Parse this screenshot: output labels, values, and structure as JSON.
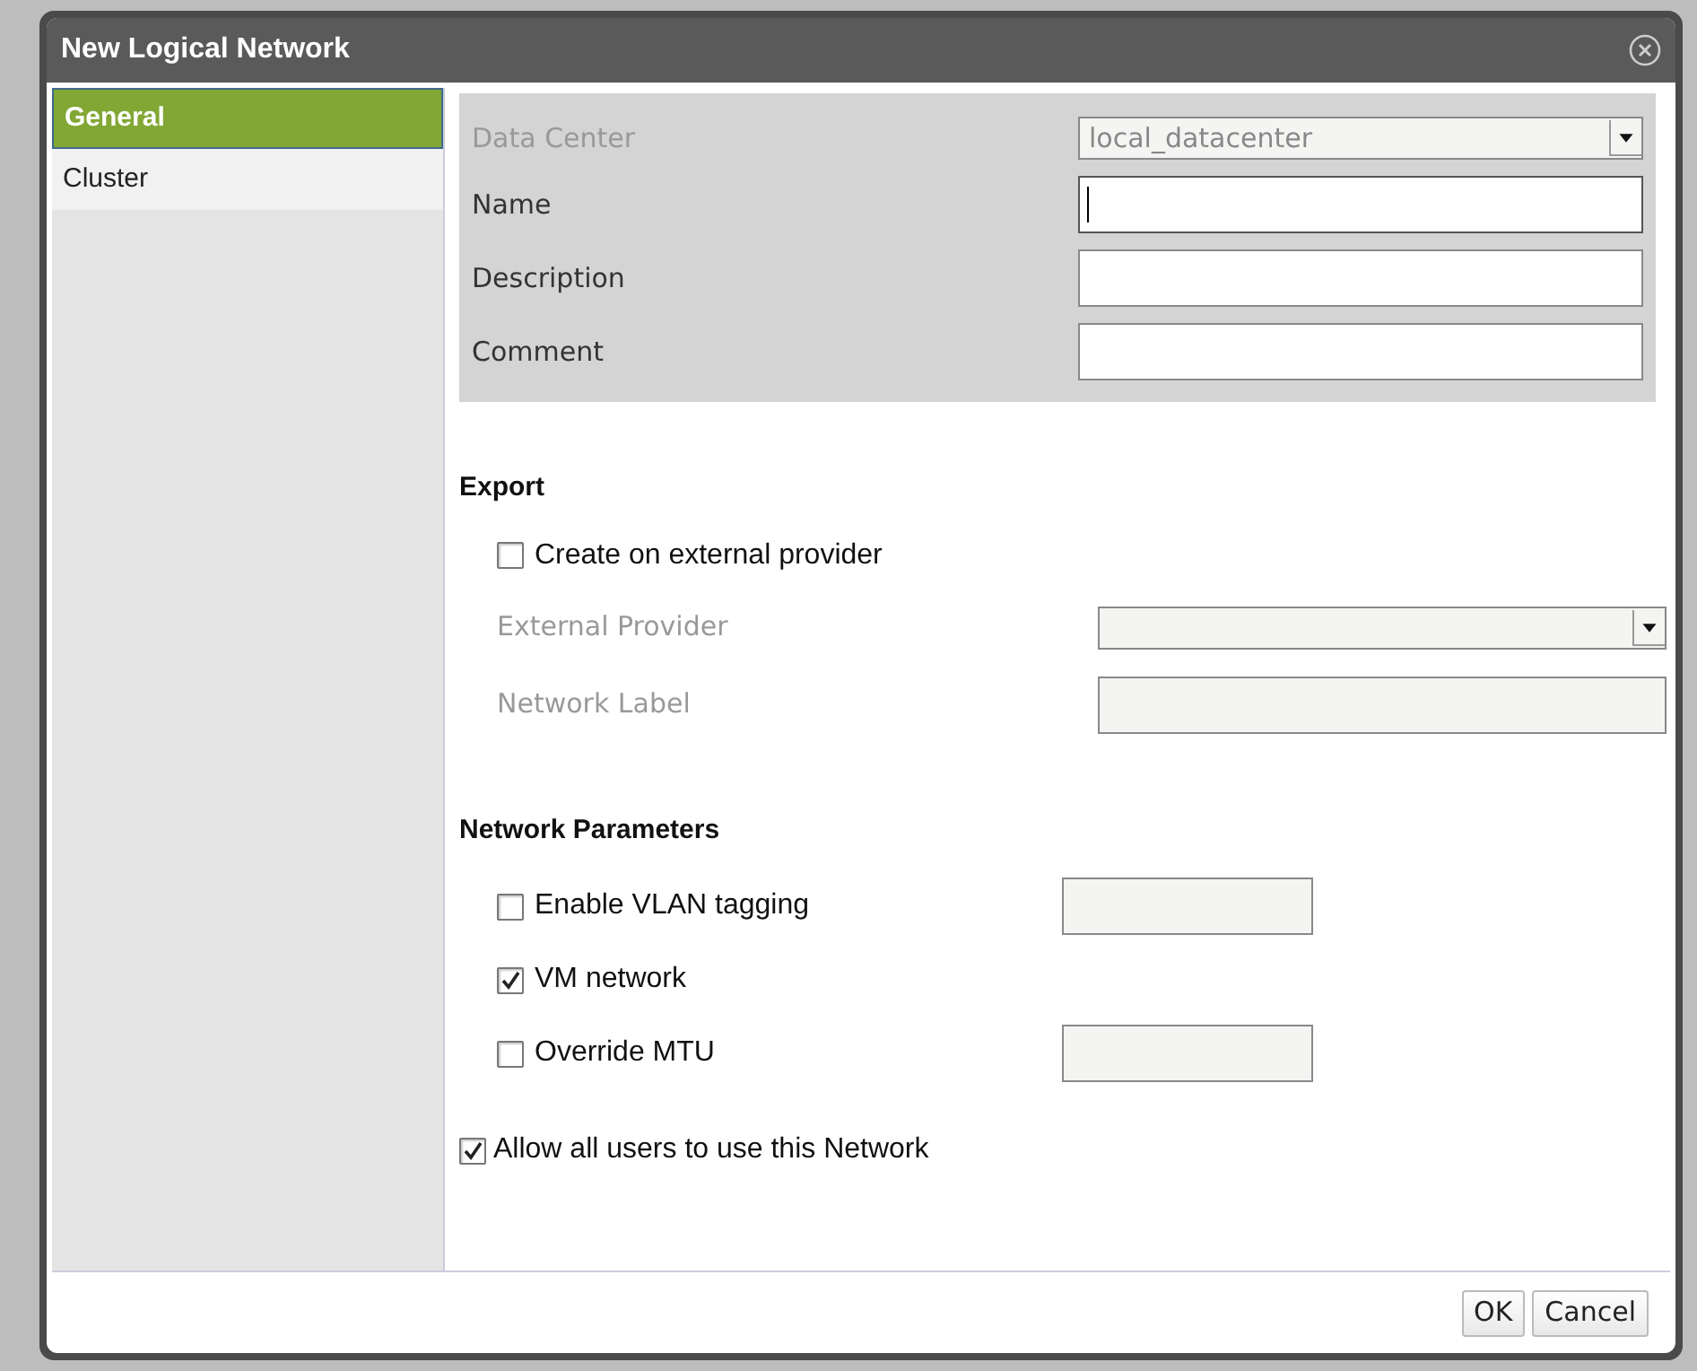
{
  "window": {
    "title": "New Logical Network"
  },
  "sidebar": {
    "items": [
      {
        "label": "General",
        "selected": true
      },
      {
        "label": "Cluster",
        "selected": false
      }
    ]
  },
  "general_fields": [
    {
      "label": "Data Center",
      "kind": "select",
      "disabled": true,
      "value": "local_datacenter"
    },
    {
      "label": "Name",
      "kind": "text",
      "disabled": false,
      "focused": true
    },
    {
      "label": "Description",
      "kind": "text",
      "disabled": false,
      "focused": false
    },
    {
      "label": "Comment",
      "kind": "text",
      "disabled": false,
      "focused": false
    }
  ],
  "export": {
    "heading": "Export",
    "create_checkbox": {
      "label": "Create on external provider",
      "checked": false
    },
    "fields": [
      {
        "label": "External Provider",
        "kind": "select",
        "disabled": true
      },
      {
        "label": "Network Label",
        "kind": "text",
        "disabled": true
      }
    ]
  },
  "network_parameters": {
    "heading": "Network Parameters",
    "options": [
      {
        "label": "Enable VLAN tagging",
        "checked": false,
        "has_field": true
      },
      {
        "label": "VM network",
        "checked": true,
        "has_field": false
      },
      {
        "label": "Override MTU",
        "checked": false,
        "has_field": true
      }
    ]
  },
  "allow_all_users": {
    "label": "Allow all users to use this Network",
    "checked": true
  },
  "buttons": [
    "OK",
    "Cancel"
  ]
}
